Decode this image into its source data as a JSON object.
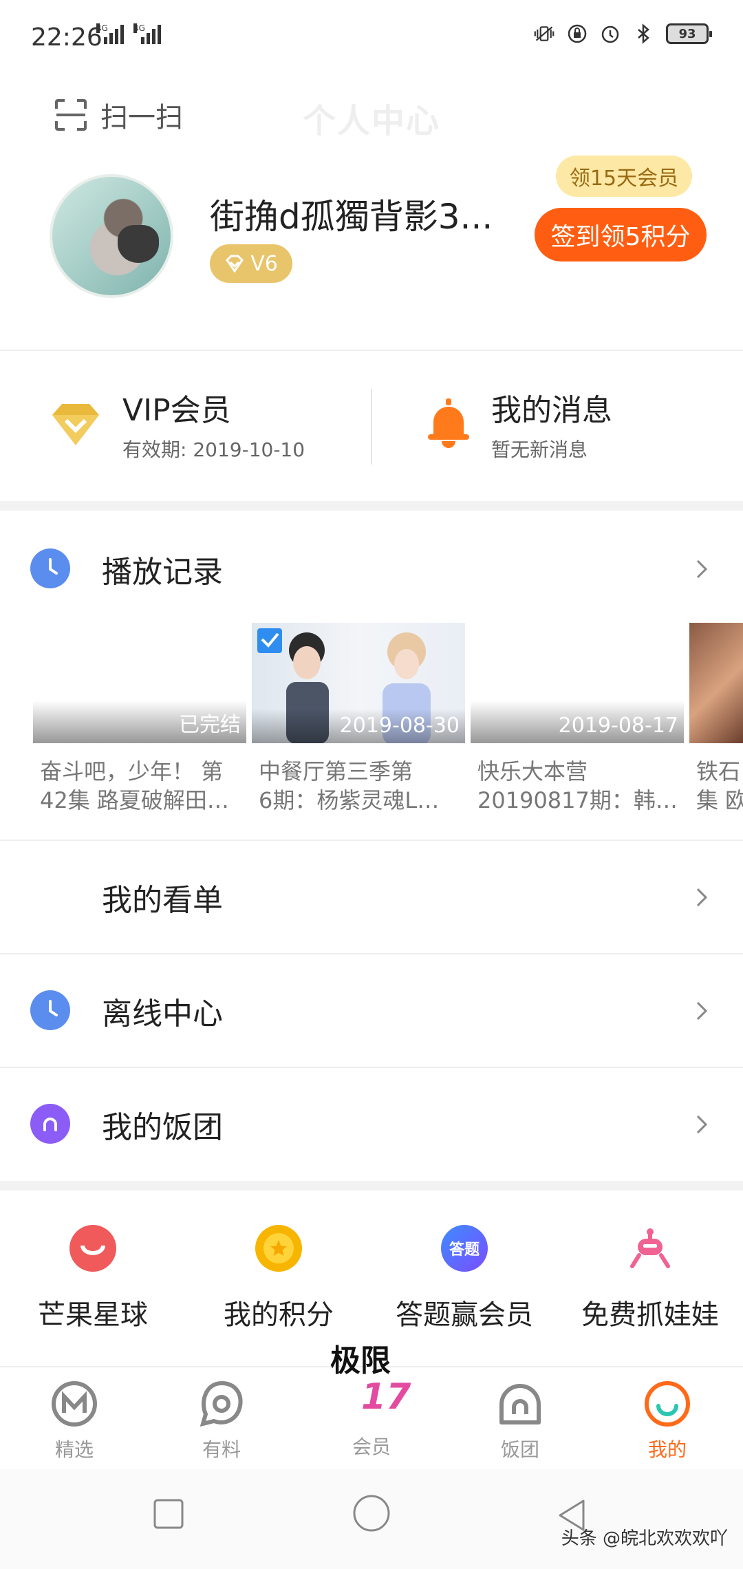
{
  "status_bar": {
    "time": "22:26",
    "sim1_label": "4G",
    "sim2_label": "4G",
    "battery": "93"
  },
  "header": {
    "scan_label": "扫一扫",
    "title": "个人中心"
  },
  "profile": {
    "username": "街捔d孤獨背影3...",
    "level": "V6",
    "coupon_label": "领15天会员",
    "checkin_label": "签到领5积分"
  },
  "vip": {
    "title": "VIP会员",
    "expiry": "有效期: 2019-10-10"
  },
  "messages": {
    "title": "我的消息",
    "status": "暂无新消息"
  },
  "history": {
    "title": "播放记录",
    "items": [
      {
        "stamp": "已完结",
        "line1": "奋斗吧，少年！ 第",
        "line2": "42集 路夏破解田…"
      },
      {
        "stamp": "2019-08-30",
        "line1": "中餐厅第三季第",
        "line2": "6期：杨紫灵魂L…"
      },
      {
        "stamp": "2019-08-17",
        "line1": "快乐大本营",
        "line2": "20190817期：韩…"
      },
      {
        "stamp": "",
        "line1": "铁石",
        "line2": "集 欧"
      }
    ]
  },
  "menu": {
    "watchlist": "我的看单",
    "offline": "离线中心",
    "fantuan": "我的饭团"
  },
  "features": [
    {
      "label": "芒果星球",
      "icon": "mango-planet-icon",
      "color": "#f05a5a"
    },
    {
      "label": "我的积分",
      "icon": "star-coin-icon",
      "color": "#f7b500"
    },
    {
      "label": "答题赢会员",
      "icon": "quiz-icon",
      "color": "#3d8cff",
      "icon_text": "答题"
    },
    {
      "label": "免费抓娃娃",
      "icon": "claw-machine-icon",
      "color": "#f06292"
    }
  ],
  "tabs": [
    {
      "label": "精选",
      "icon": "featured-icon"
    },
    {
      "label": "有料",
      "icon": "discover-icon"
    },
    {
      "label": "会员",
      "icon": "vip-icon",
      "logo_text": "极限",
      "logo_number": "17"
    },
    {
      "label": "饭团",
      "icon": "fantuan-icon"
    },
    {
      "label": "我的",
      "icon": "profile-icon"
    }
  ],
  "colors": {
    "accent": "#ff5e12",
    "active_tab": "#ff6a1a",
    "clock_icon": "#5b8def",
    "fantuan_icon": "#8b5cf6",
    "bell_icon": "#ff7a1a",
    "vip_gold": "#e8b93b"
  },
  "watermark": "头条 @皖北欢欢欢吖"
}
